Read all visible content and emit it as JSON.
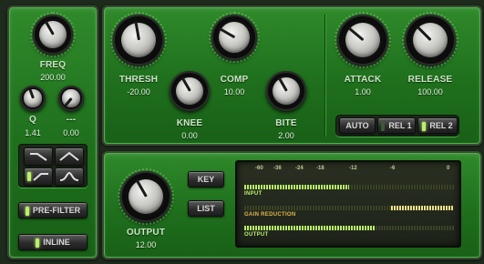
{
  "filter": {
    "freq": {
      "label": "FREQ",
      "value": "200.00"
    },
    "q": {
      "label": "Q",
      "value": "1.41"
    },
    "third": {
      "label": "---",
      "value": "0.00"
    },
    "pre_filter": "PRE-FILTER",
    "inline": "INLINE"
  },
  "compressor": {
    "thresh": {
      "label": "THRESH",
      "value": "-20.00"
    },
    "comp": {
      "label": "COMP",
      "value": "10.00"
    },
    "knee": {
      "label": "KNEE",
      "value": "0.00"
    },
    "bite": {
      "label": "BITE",
      "value": "2.00"
    },
    "attack": {
      "label": "ATTACK",
      "value": "1.00"
    },
    "release": {
      "label": "RELEASE",
      "value": "100.00"
    },
    "modes": [
      "AUTO",
      "REL 1",
      "REL 2"
    ]
  },
  "output": {
    "label": "OUTPUT",
    "value": "12.00",
    "key": "KEY",
    "list": "LIST"
  },
  "meters": {
    "scale": [
      "-60",
      "-36",
      "-24",
      "-18",
      "-12",
      "-6",
      "0"
    ],
    "input_label": "INPUT",
    "gain_label": "GAIN REDUCTION",
    "output_label": "OUTPUT",
    "input_level": 0.5,
    "gain_reduction": 0.3,
    "output_level": 0.62
  },
  "colors": {
    "panel_green": "#2f8a2a",
    "led_on": "#b8f06a",
    "meter_text": "#c9c59a"
  }
}
